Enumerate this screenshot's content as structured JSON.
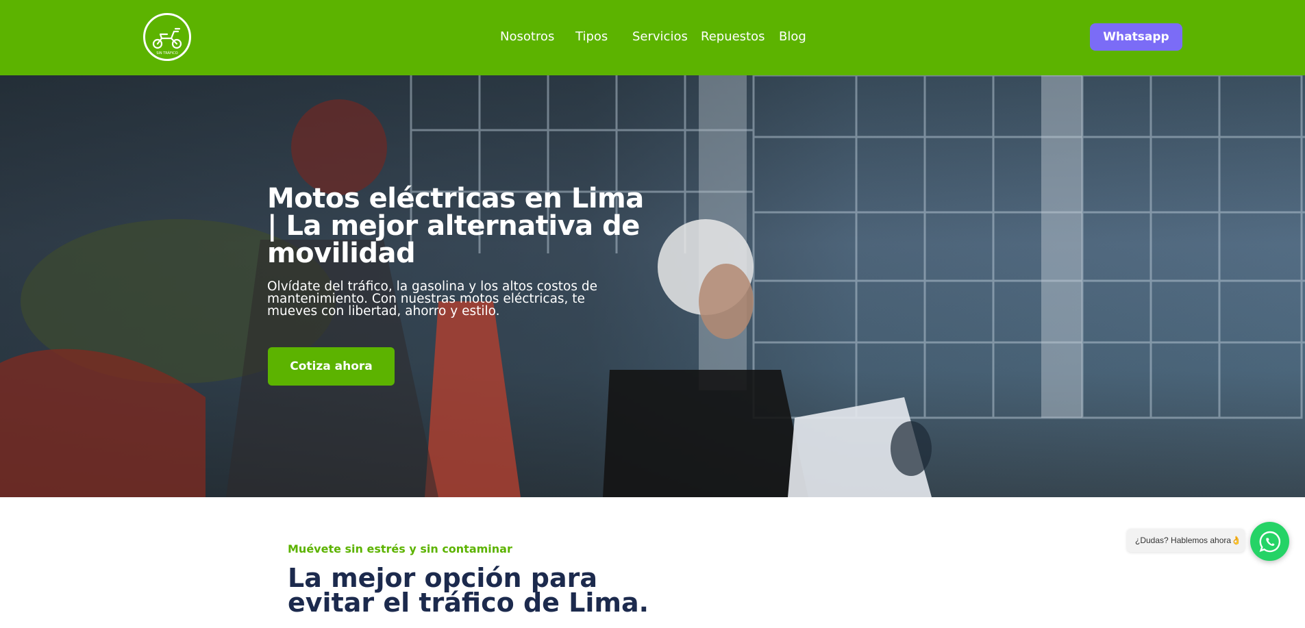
{
  "header": {
    "logo_icon": "scooter-logo-icon",
    "logo_caption": "SIN TRÁFICO",
    "nav": [
      {
        "label": "Nosotros"
      },
      {
        "label": "Tipos"
      },
      {
        "label": "Servicios"
      },
      {
        "label": "Repuestos"
      },
      {
        "label": "Blog"
      }
    ],
    "whatsapp_label": "Whatsapp"
  },
  "hero": {
    "title": "Motos eléctricas en Lima | La mejor alternativa de movilidad",
    "subtitle": "Olvídate del tráfico, la gasolina y los altos costos de mantenimiento. Con nuestras motos eléctricas, te mueves con libertad, ahorro y estilo.",
    "cta_label": "Cotiza ahora"
  },
  "section": {
    "eyebrow": "Muévete sin estrés y sin contaminar",
    "title": "La mejor opción para evitar el tráfico de Lima."
  },
  "chat": {
    "bubble_text": "¿Dudas? Hablemos ahora👌",
    "icon": "whatsapp-icon"
  },
  "colors": {
    "brand_green": "#5cb300",
    "whatsapp_button": "#7b6cf6",
    "heading_navy": "#1c2a4d",
    "whatsapp_float": "#25d366"
  }
}
